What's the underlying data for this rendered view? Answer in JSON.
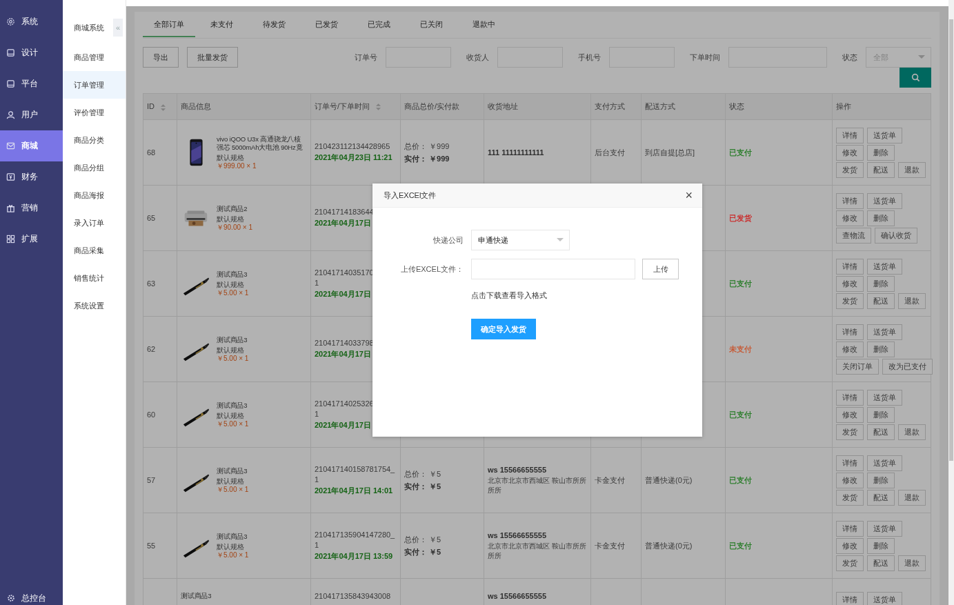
{
  "sidebar": {
    "items": [
      {
        "label": "系统",
        "selected": false
      },
      {
        "label": "设计",
        "selected": false
      },
      {
        "label": "平台",
        "selected": false
      },
      {
        "label": "用户",
        "selected": false
      },
      {
        "label": "商城",
        "selected": true
      },
      {
        "label": "财务",
        "selected": false
      },
      {
        "label": "营销",
        "selected": false
      },
      {
        "label": "扩展",
        "selected": false
      }
    ],
    "footer": {
      "label": "总控台"
    }
  },
  "subnav": {
    "title": "商城系统",
    "collapse": "«",
    "items": [
      {
        "label": "商品管理",
        "selected": false
      },
      {
        "label": "订单管理",
        "selected": true
      },
      {
        "label": "评价管理",
        "selected": false
      },
      {
        "label": "商品分类",
        "selected": false
      },
      {
        "label": "商品分组",
        "selected": false
      },
      {
        "label": "商品海报",
        "selected": false
      },
      {
        "label": "录入订单",
        "selected": false
      },
      {
        "label": "商品采集",
        "selected": false
      },
      {
        "label": "销售统计",
        "selected": false
      },
      {
        "label": "系统设置",
        "selected": false
      }
    ]
  },
  "tabs": [
    {
      "label": "全部订单",
      "selected": true
    },
    {
      "label": "未支付",
      "selected": false
    },
    {
      "label": "待发货",
      "selected": false
    },
    {
      "label": "已发货",
      "selected": false
    },
    {
      "label": "已完成",
      "selected": false
    },
    {
      "label": "已关闭",
      "selected": false
    },
    {
      "label": "退款中",
      "selected": false
    }
  ],
  "toolbar": {
    "buttons": [
      "导出",
      "批量发货"
    ],
    "filters": [
      {
        "label": "订单号",
        "kind": "input"
      },
      {
        "label": "收货人",
        "kind": "input"
      },
      {
        "label": "手机号",
        "kind": "input"
      },
      {
        "label": "下单时间",
        "kind": "date"
      },
      {
        "label": "状态",
        "kind": "select",
        "placeholder": "全部"
      }
    ]
  },
  "table": {
    "columns": [
      {
        "label": "ID",
        "sortable": true
      },
      {
        "label": "商品信息",
        "sortable": false
      },
      {
        "label": "订单号/下单时间",
        "sortable": true
      },
      {
        "label": "商品总价/实付款",
        "sortable": false
      },
      {
        "label": "收货地址",
        "sortable": false
      },
      {
        "label": "支付方式",
        "sortable": false
      },
      {
        "label": "配送方式",
        "sortable": false
      },
      {
        "label": "状态",
        "sortable": false
      },
      {
        "label": "操作",
        "sortable": false
      }
    ],
    "rows": [
      {
        "id": "68",
        "product": {
          "name": "vivo iQOO U3x 高通骁龙八核强芯 5000mAh大电池 90Hz竟",
          "spec": "默认规格",
          "price": "￥999.00 × 1"
        },
        "order_lines": [
          "210423112134428965"
        ],
        "time": "2021年04月23日 11:21",
        "total": "总价： ￥999",
        "paid": "实付： ￥999",
        "recipient": "111 11111111111",
        "payment": "后台支付",
        "shipping": "到店自提[总店]",
        "status": {
          "text": "已支付",
          "color": "#217a21"
        },
        "actions": [
          [
            "详情",
            "送货单"
          ],
          [
            "修改",
            "删除"
          ],
          [
            "发货",
            "配送",
            "退款"
          ]
        ]
      },
      {
        "id": "65",
        "product": {
          "name": "测试商品2",
          "spec": "默认规格",
          "price": "￥90.00 × 1"
        },
        "order_lines": [
          "21041714183644"
        ],
        "time": "2021年04月17日",
        "status": {
          "text": "已发货",
          "color": "#cc2222"
        },
        "actions": [
          [
            "详情",
            "送货单"
          ],
          [
            "修改",
            "删除"
          ],
          [
            "查物流",
            "确认收货"
          ]
        ]
      },
      {
        "id": "63",
        "product": {
          "name": "测试商品3",
          "spec": "默认规格",
          "price": "￥5.00 × 1"
        },
        "order_lines": [
          "21041714035170",
          "1"
        ],
        "time": "2021年04月17日",
        "status": {
          "text": "已支付",
          "color": "#217a21"
        },
        "actions": [
          [
            "详情",
            "送货单"
          ],
          [
            "修改",
            "删除"
          ],
          [
            "发货",
            "配送",
            "退款"
          ]
        ]
      },
      {
        "id": "62",
        "product": {
          "name": "测试商品3",
          "spec": "默认规格",
          "price": "￥5.00 × 1"
        },
        "order_lines": [
          "21041714033798"
        ],
        "time": "2021年04月17日",
        "status": {
          "text": "未支付",
          "color": "#c8552e"
        },
        "actions": [
          [
            "详情",
            "送货单"
          ],
          [
            "修改",
            "删除"
          ],
          [
            "关闭订单",
            "改为已支付"
          ]
        ]
      },
      {
        "id": "60",
        "product": {
          "name": "测试商品3",
          "spec": "默认规格",
          "price": "￥5.00 × 1"
        },
        "order_lines": [
          "21041714025326",
          "1"
        ],
        "time": "2021年04月17日",
        "status": {
          "text": "已支付",
          "color": "#217a21"
        },
        "actions": [
          [
            "详情",
            "送货单"
          ],
          [
            "修改",
            "删除"
          ],
          [
            "发货",
            "配送",
            "退款"
          ]
        ]
      },
      {
        "id": "57",
        "product": {
          "name": "测试商品3",
          "spec": "默认规格",
          "price": "￥5.00 × 1"
        },
        "order_lines": [
          "210417140158781754_",
          "1"
        ],
        "time": "2021年04月17日 14:01",
        "total": "总价： ￥5",
        "paid": "实付： ￥5",
        "recipient": "ws 15566655555",
        "address": "北京市北京市西城区 鞍山市所所所所",
        "payment": "卡金支付",
        "shipping": "普通快递(0元)",
        "status": {
          "text": "已支付",
          "color": "#217a21"
        },
        "actions": [
          [
            "详情",
            "送货单"
          ],
          [
            "修改",
            "删除"
          ],
          [
            "发货",
            "配送",
            "退款"
          ]
        ]
      },
      {
        "id": "55",
        "product": {
          "name": "测试商品3",
          "spec": "默认规格",
          "price": "￥5.00 × 1"
        },
        "order_lines": [
          "210417135904147280_",
          "1"
        ],
        "time": "2021年04月17日 13:59",
        "total": "总价： ￥5",
        "paid": "实付： ￥5",
        "recipient": "ws 15566655555",
        "address": "北京市北京市西城区 鞍山市所所所所",
        "payment": "卡金支付",
        "shipping": "普通快递(0元)",
        "status": {
          "text": "已支付",
          "color": "#217a21"
        },
        "actions": [
          [
            "详情",
            "送货单"
          ],
          [
            "修改",
            "删除"
          ],
          [
            "发货",
            "配送",
            "退款"
          ]
        ]
      },
      {
        "product": {
          "name": "测试商品3"
        },
        "order_lines": [
          "210417135843943008"
        ],
        "recipient": "ws 15566655555",
        "actions": [
          [
            "详情",
            "送货单"
          ]
        ]
      }
    ]
  },
  "modal": {
    "title": "导入EXCEl文件",
    "close": "×",
    "fields": [
      {
        "label": "快递公司",
        "kind": "select",
        "value": "申通快递"
      },
      {
        "label": "上传EXCEL文件：",
        "kind": "upload",
        "button": "上传"
      }
    ],
    "link": "点击下载查看导入格式",
    "submit": "确定导入发货"
  }
}
